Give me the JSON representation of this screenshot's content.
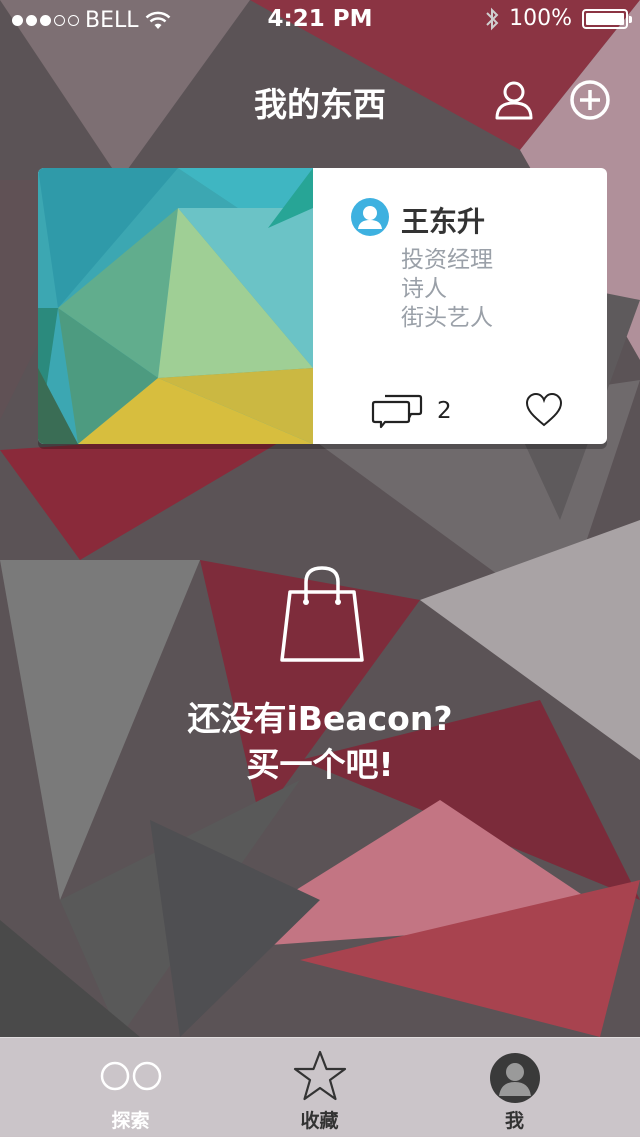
{
  "status_bar": {
    "carrier": "BELL",
    "time": "4:21 PM",
    "battery": "100%"
  },
  "nav": {
    "title": "我的东西",
    "profile_icon": "person-outline-icon",
    "add_icon": "plus-circle-icon"
  },
  "card": {
    "user_name": "王东升",
    "tags": [
      "投资经理",
      "诗人",
      "街头艺人"
    ],
    "comment_count": "2",
    "comment_icon": "comment-icon",
    "like_icon": "heart-icon"
  },
  "empty_state": {
    "icon": "shopping-bag-icon",
    "line1": "还没有iBeacon?",
    "line2": "买一个吧!"
  },
  "tabbar": {
    "tabs": [
      {
        "label": "探索",
        "icon": "explore-icon"
      },
      {
        "label": "收藏",
        "icon": "star-icon"
      },
      {
        "label": "我",
        "icon": "user-avatar-icon"
      }
    ]
  },
  "colors": {
    "accent_blue": "#3eb1e0",
    "tag_gray": "#9aa0a8",
    "bg_red": "#9e2f40"
  }
}
